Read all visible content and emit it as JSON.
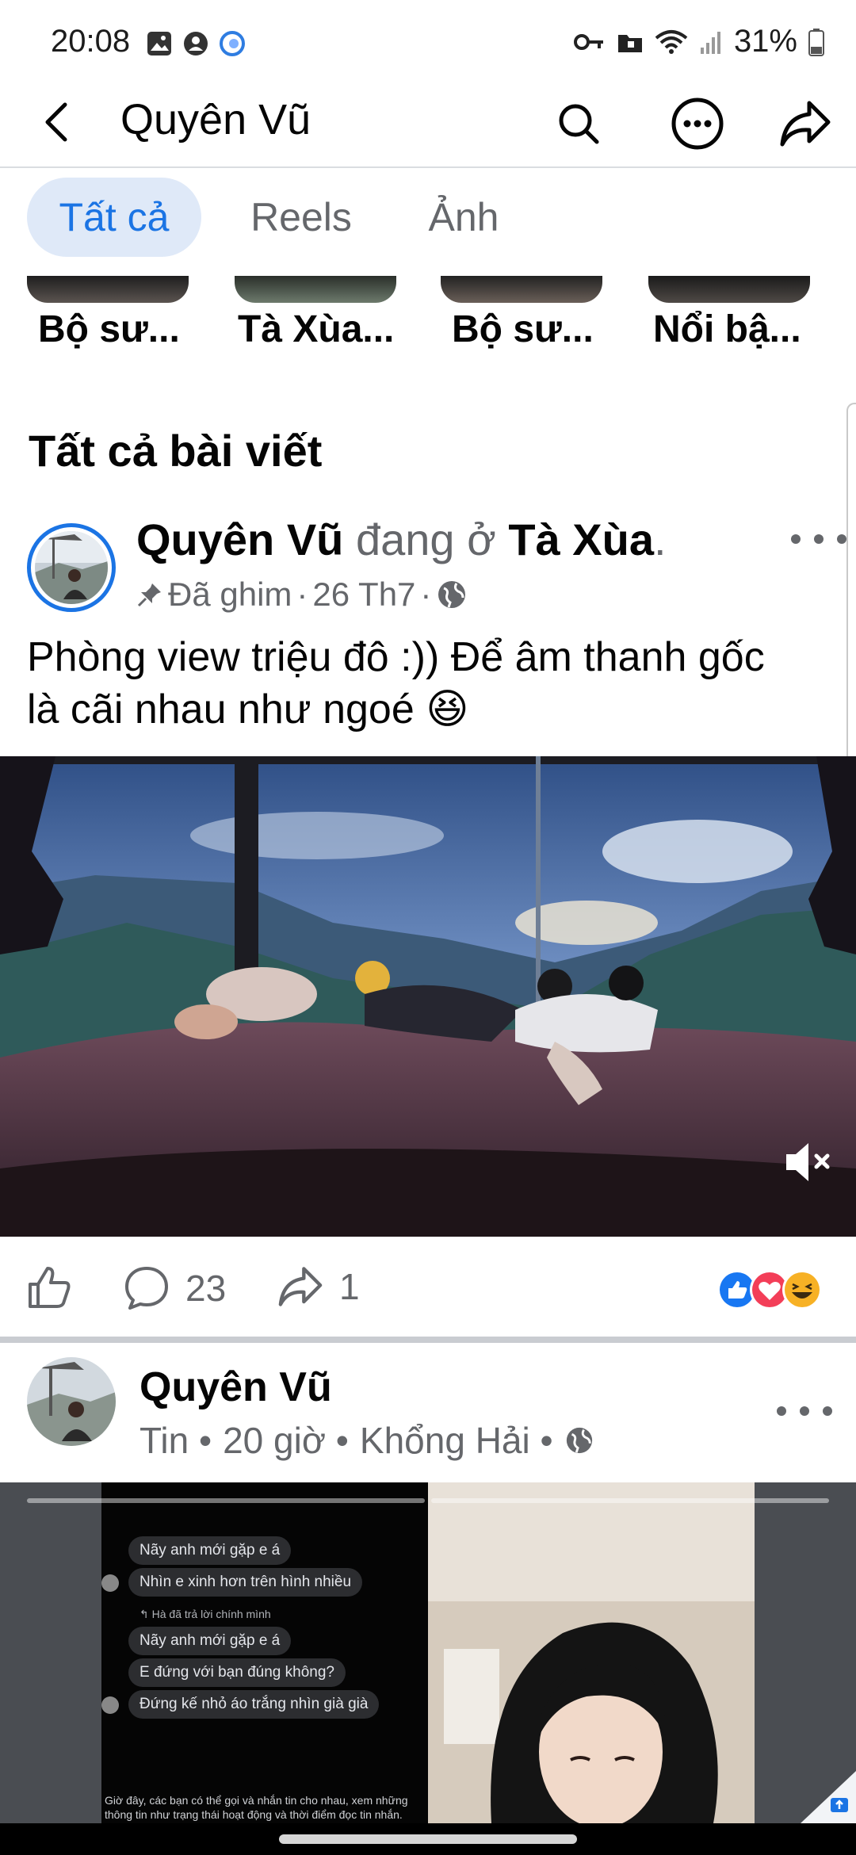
{
  "status_bar": {
    "time": "20:08",
    "battery": "31%",
    "left_icons": [
      "gallery-icon",
      "account-icon",
      "messenger-icon"
    ],
    "right_icons": [
      "key-icon",
      "folder-icon",
      "wifi-icon",
      "signal-icon",
      "battery-icon"
    ]
  },
  "header": {
    "title": "Quyên Vũ",
    "icons": [
      "back-icon",
      "search-icon",
      "more-icon",
      "share-icon"
    ]
  },
  "filters": [
    {
      "label": "Tất cả",
      "active": true
    },
    {
      "label": "Reels",
      "active": false
    },
    {
      "label": "Ảnh",
      "active": false
    }
  ],
  "albums": [
    {
      "label": "Bộ sư..."
    },
    {
      "label": "Tà Xùa..."
    },
    {
      "label": "Bộ sư..."
    },
    {
      "label": "Nổi bậ..."
    }
  ],
  "section_title": "Tất cả bài viết",
  "post1": {
    "author": "Quyên Vũ",
    "connector": "đang ở",
    "place": "Tà Xùa",
    "place_suffix": ".",
    "pinned": "Đã ghim",
    "dot1": "·",
    "date": "26 Th7",
    "dot2": "·",
    "text_line1": "Phòng view triệu đô :)) Để âm thanh gốc",
    "text_line2": "là cãi nhau như ngoé 😆",
    "comments": "23",
    "shares": "1",
    "reactions": [
      "like",
      "love",
      "haha"
    ]
  },
  "post2": {
    "author": "Quyên Vũ",
    "meta_type": "Tin •",
    "meta_time": "20 giờ •",
    "meta_place": "Khổng Hải •",
    "chat": {
      "bubbles": [
        "Nãy anh mới gặp e á",
        "Nhìn e xinh hơn trên hình nhiều",
        "Nãy anh mới gặp e á",
        "E đứng với bạn đúng không?",
        "Đứng kế nhỏ áo trắng nhìn già già"
      ],
      "reply_note": "↰ Hà đã trả lời chính mình",
      "footer": "Giờ đây, các bạn có thể gọi và nhắn tin cho nhau, xem những thông tin như trạng thái hoạt động và thời điểm đọc tin nhắn."
    }
  },
  "colors": {
    "accent": "#1b74e4",
    "chip_active_bg": "#dfe9f8",
    "secondary_text": "#65676b",
    "like": "#1877f2",
    "love": "#f33e58",
    "haha": "#f7b125"
  }
}
